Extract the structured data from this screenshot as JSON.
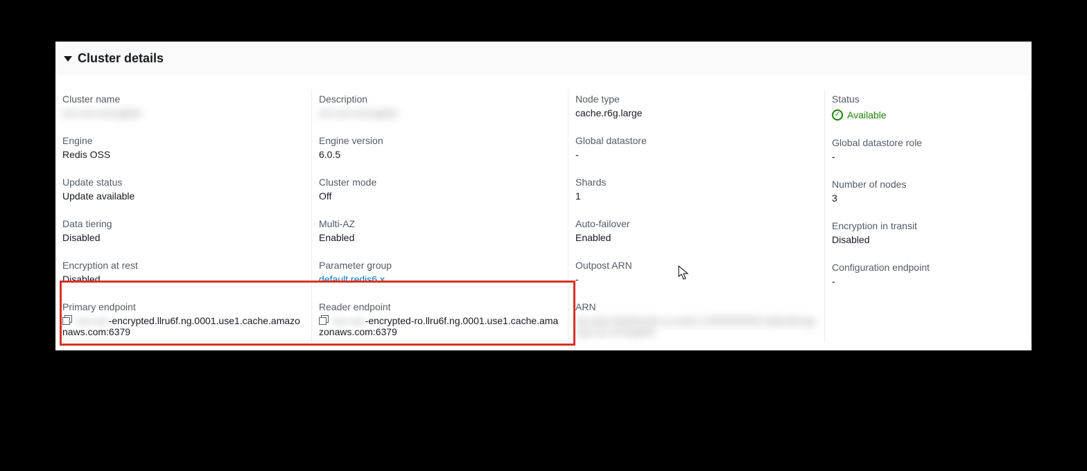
{
  "section_title": "Cluster details",
  "col1": {
    "cluster_name": {
      "label": "Cluster name",
      "value": "xxx-xxx-encrypted"
    },
    "engine": {
      "label": "Engine",
      "value": "Redis OSS"
    },
    "update_status": {
      "label": "Update status",
      "value": "Update available"
    },
    "data_tiering": {
      "label": "Data tiering",
      "value": "Disabled"
    },
    "encryption_at_rest": {
      "label": "Encryption at rest",
      "value": "Disabled"
    },
    "primary_endpoint": {
      "label": "Primary endpoint",
      "prefix": "xxx-xxx",
      "suffix": "-encrypted.llru6f.ng.0001.use1.cache.amazonaws.com:6379"
    }
  },
  "col2": {
    "description": {
      "label": "Description",
      "value": "xxx-xxx-encrypted"
    },
    "engine_version": {
      "label": "Engine version",
      "value": "6.0.5"
    },
    "cluster_mode": {
      "label": "Cluster mode",
      "value": "Off"
    },
    "multi_az": {
      "label": "Multi-AZ",
      "value": "Enabled"
    },
    "parameter_group": {
      "label": "Parameter group",
      "value": "default.redis6.x"
    },
    "reader_endpoint": {
      "label": "Reader endpoint",
      "prefix": "xxx-xxx",
      "suffix": "-encrypted-ro.llru6f.ng.0001.use1.cache.amazonaws.com:6379"
    }
  },
  "col3": {
    "node_type": {
      "label": "Node type",
      "value": "cache.r6g.large"
    },
    "global_datastore": {
      "label": "Global datastore",
      "value": "-"
    },
    "shards": {
      "label": "Shards",
      "value": "1"
    },
    "auto_failover": {
      "label": "Auto-failover",
      "value": "Enabled"
    },
    "outpost_arn": {
      "label": "Outpost ARN",
      "value": "-"
    },
    "arn": {
      "label": "ARN",
      "value": "arn:aws:elasticache:us-east-1:0000000000:replicationgroup:xxx-encrypted"
    }
  },
  "col4": {
    "status": {
      "label": "Status",
      "value": "Available"
    },
    "global_datastore_role": {
      "label": "Global datastore role",
      "value": "-"
    },
    "number_of_nodes": {
      "label": "Number of nodes",
      "value": "3"
    },
    "encryption_in_transit": {
      "label": "Encryption in transit",
      "value": "Disabled"
    },
    "configuration_endpoint": {
      "label": "Configuration endpoint",
      "value": "-"
    }
  }
}
